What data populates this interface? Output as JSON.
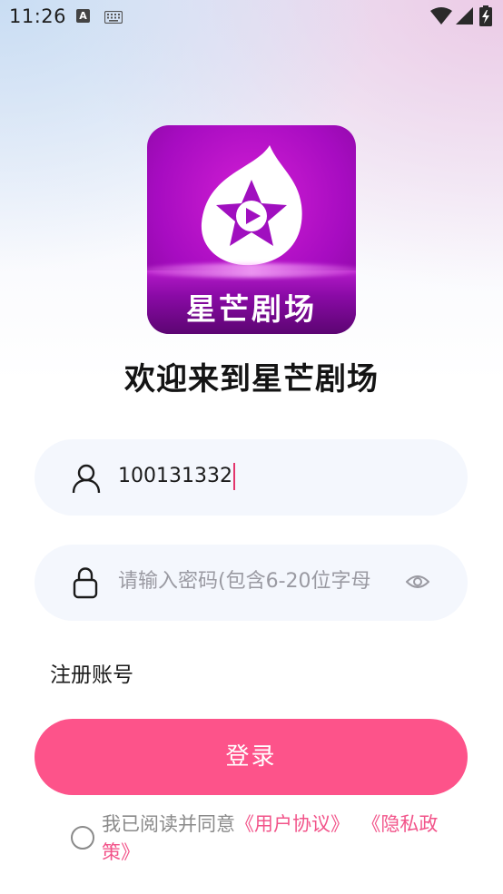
{
  "status_bar": {
    "time": "11:26",
    "notification_letter": "A"
  },
  "app": {
    "logo_text": "星芒剧场",
    "welcome_title": "欢迎来到星芒剧场"
  },
  "form": {
    "username_value": "100131332",
    "password_placeholder": "请输入密码(包含6-20位字母",
    "register_label": "注册账号",
    "login_label": "登录"
  },
  "agreement": {
    "prefix": "我已阅读并同意",
    "user_agreement": "《用户协议》",
    "separator": "  ",
    "privacy_policy": "《隐私政策》"
  },
  "colors": {
    "accent": "#fd538a",
    "link": "#f2548a",
    "logo_purple": "#a70cc1"
  }
}
